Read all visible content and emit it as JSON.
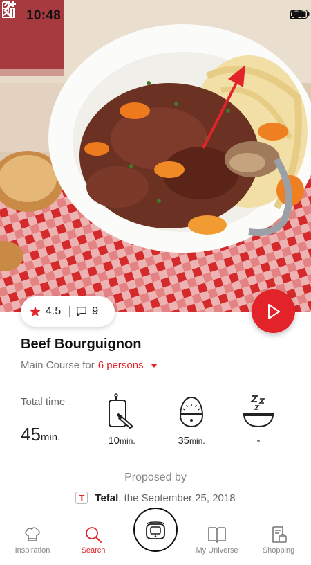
{
  "status_bar": {
    "time": "10:48",
    "icons": [
      "cellular-signal-icon",
      "wifi-icon",
      "battery-icon"
    ]
  },
  "navigation": {
    "back_icon": "chevron-left-icon",
    "save_icon": "bookmark-add-icon",
    "share_icon": "share-icon"
  },
  "recipe": {
    "rating": "4.5",
    "comments": "9",
    "title": "Beef Bourguignon",
    "course_prefix": "Main Course for",
    "persons": "6 persons",
    "total_time_label": "Total time",
    "total_time_value": "45",
    "total_time_unit": "min.",
    "times": [
      {
        "icon": "prep-knife-icon",
        "value": "10",
        "unit": "min."
      },
      {
        "icon": "timer-icon",
        "value": "35",
        "unit": "min."
      },
      {
        "icon": "resting-pot-icon",
        "value": "-",
        "unit": ""
      }
    ],
    "proposed_by_label": "Proposed by",
    "brand_letter": "T",
    "author": "Tefal",
    "date_text": ", the September 25, 2018"
  },
  "tab_bar": {
    "tabs": [
      {
        "label": "Inspiration",
        "icon": "chef-hat-icon",
        "active": false
      },
      {
        "label": "Search",
        "icon": "search-icon",
        "active": true
      },
      {
        "label": "My Universe",
        "icon": "book-icon",
        "active": false
      },
      {
        "label": "Shopping",
        "icon": "shopping-list-icon",
        "active": false
      }
    ],
    "center_icon": "cooker-icon"
  },
  "colors": {
    "accent": "#e2242a",
    "text": "#222222",
    "muted": "#888888",
    "annotation_arrow": "#e2242a"
  }
}
